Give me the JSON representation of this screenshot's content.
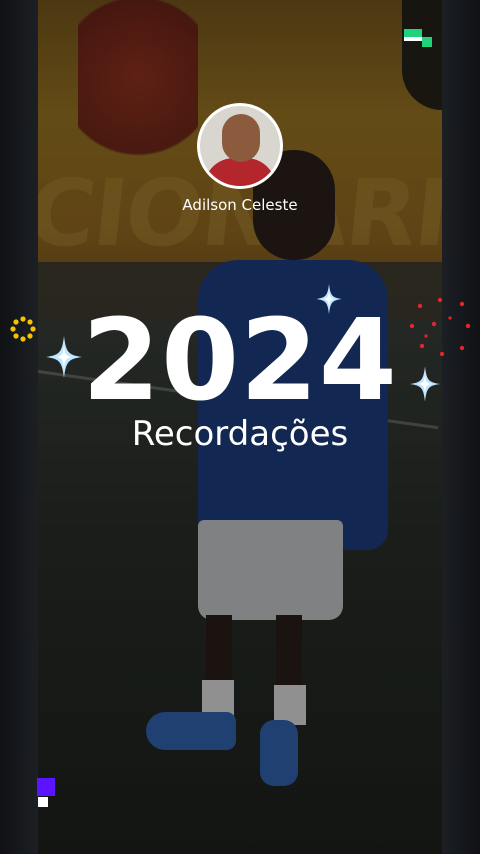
{
  "story": {
    "username": "Adilson Celeste",
    "year": "2024",
    "subtitle": "Recordações"
  },
  "colors": {
    "accent_green": "#1ed37a",
    "sparkle_blue": "#bfe6ff",
    "red_dots": "#e3262b",
    "yellow_ring": "#f5c400",
    "glitch_purple": "#5b14ff"
  }
}
